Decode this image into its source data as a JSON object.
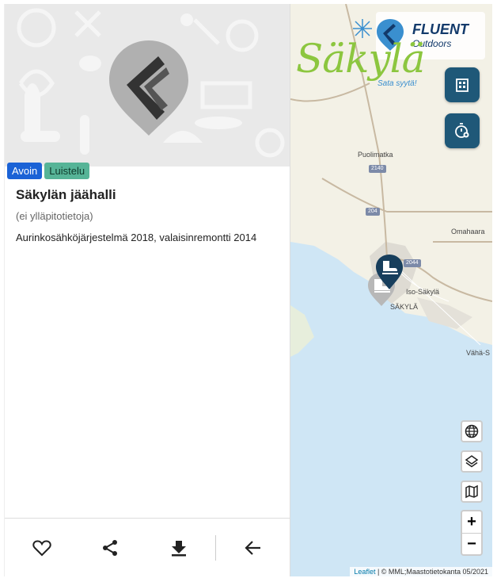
{
  "place": {
    "status_badge": "Avoin",
    "category_badge": "Luistelu",
    "title": "Säkylän jäähalli",
    "maintainer": "(ei ylläpitotietoja)",
    "description": "Aurinkosähköjärjestelmä 2018, valaisinremontti 2014"
  },
  "actions": [
    "favorite",
    "share",
    "download",
    "back"
  ],
  "map": {
    "brand": {
      "name": "FLUENT",
      "sub": "Outdoors"
    },
    "town_logo": "Säkylä",
    "town_slogan": "Sata syytä!",
    "places": [
      "Puolimatka",
      "Omahaara",
      "Iso-Säkylä",
      "SÄKYLÄ",
      "Vähä-S"
    ],
    "roads": [
      "2140",
      "204",
      "2044"
    ],
    "zoom_in": "+",
    "zoom_out": "−",
    "attribution_link": "Leaflet",
    "attribution_text": " | © MML;Maastotietokanta 05/2021"
  },
  "colors": {
    "badge_open": "#1a62d6",
    "badge_category": "#56b497",
    "fab": "#1f5878",
    "water": "#cfe6f5",
    "land": "#f3f1e6",
    "marker_active": "#173e5c"
  }
}
